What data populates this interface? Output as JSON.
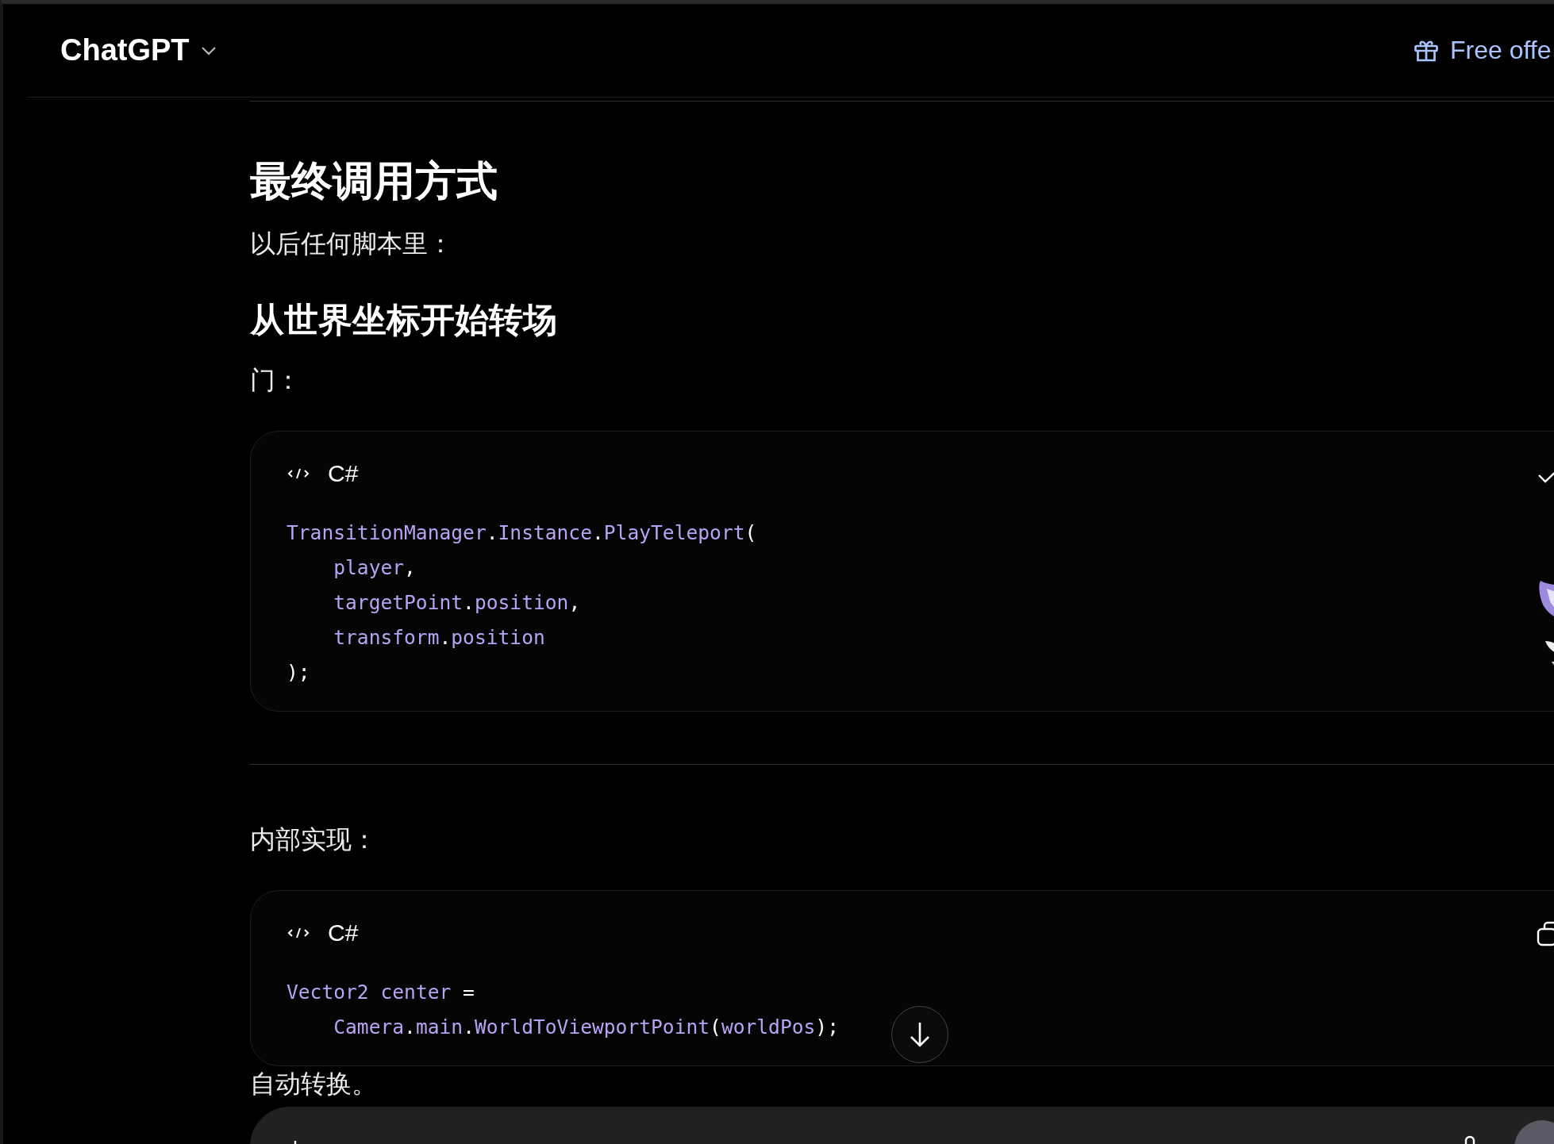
{
  "header": {
    "title": "ChatGPT",
    "offer": "Free offe"
  },
  "content": [
    {
      "kind": "heading1",
      "text": "最终调用方式"
    },
    {
      "kind": "paragraph",
      "text": "以后任何脚本里："
    },
    {
      "kind": "heading2",
      "text": "从世界坐标开始转场"
    },
    {
      "kind": "paragraph",
      "text": "门："
    },
    {
      "kind": "code",
      "language": "C#",
      "copied": true,
      "lines": [
        {
          "tokens": [
            {
              "t": "TransitionManager",
              "color": "#b7a4f5"
            },
            {
              "t": ".",
              "color": "#ffffff"
            },
            {
              "t": "Instance",
              "color": "#b7a4f5"
            },
            {
              "t": ".",
              "color": "#ffffff"
            },
            {
              "t": "PlayTeleport",
              "color": "#b7a4f5"
            },
            {
              "t": "(",
              "color": "#ffffff"
            }
          ]
        },
        {
          "tokens": [
            {
              "t": "    player",
              "color": "#b7a4f5"
            },
            {
              "t": ",",
              "color": "#ffffff"
            }
          ]
        },
        {
          "tokens": [
            {
              "t": "    targetPoint",
              "color": "#b7a4f5"
            },
            {
              "t": ".",
              "color": "#ffffff"
            },
            {
              "t": "position",
              "color": "#b7a4f5"
            },
            {
              "t": ",",
              "color": "#ffffff"
            }
          ]
        },
        {
          "tokens": [
            {
              "t": "    transform",
              "color": "#b7a4f5"
            },
            {
              "t": ".",
              "color": "#ffffff"
            },
            {
              "t": "position",
              "color": "#b7a4f5"
            }
          ]
        },
        {
          "tokens": [
            {
              "t": ");",
              "color": "#ffffff"
            }
          ]
        }
      ]
    },
    {
      "kind": "divider"
    },
    {
      "kind": "paragraph",
      "text": "内部实现："
    },
    {
      "kind": "code",
      "language": "C#",
      "copied": false,
      "lines": [
        {
          "tokens": [
            {
              "t": "Vector2",
              "color": "#b7a4f5"
            },
            {
              "t": " center",
              "color": "#b7a4f5"
            },
            {
              "t": " =",
              "color": "#ffffff"
            }
          ]
        },
        {
          "tokens": [
            {
              "t": "    Camera",
              "color": "#b7a4f5"
            },
            {
              "t": ".",
              "color": "#ffffff"
            },
            {
              "t": "main",
              "color": "#b7a4f5"
            },
            {
              "t": ".",
              "color": "#ffffff"
            },
            {
              "t": "WorldToViewportPoint",
              "color": "#b7a4f5"
            },
            {
              "t": "(",
              "color": "#ffffff"
            },
            {
              "t": "worldPos",
              "color": "#b7a4f5"
            },
            {
              "t": ");",
              "color": "#ffffff"
            }
          ]
        }
      ]
    },
    {
      "kind": "paragraph",
      "text": "自动转换。"
    }
  ]
}
